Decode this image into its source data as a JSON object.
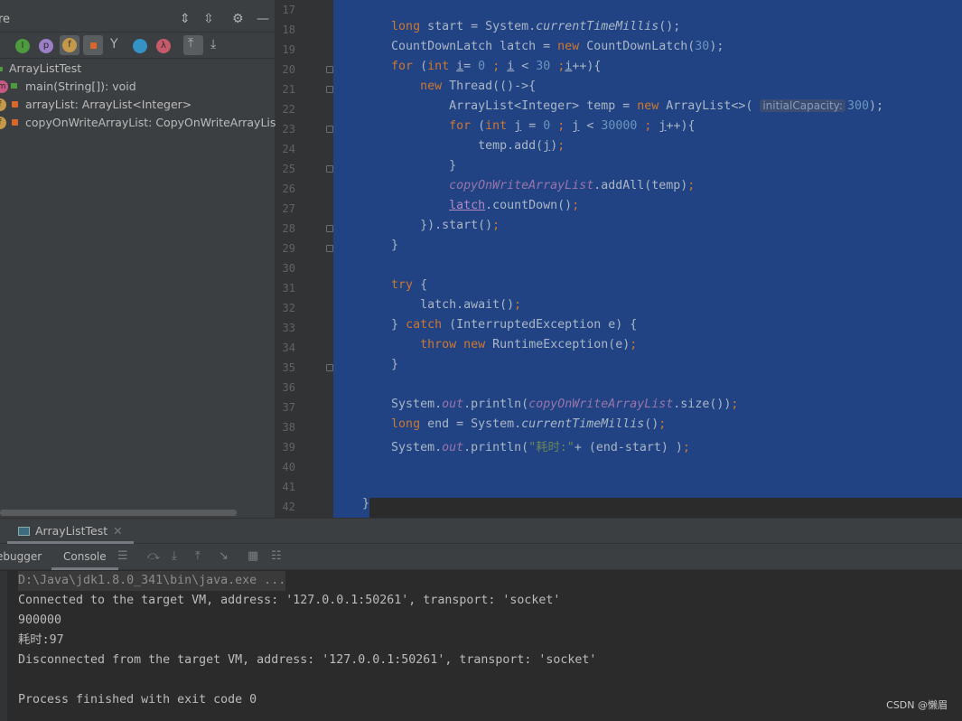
{
  "structure": {
    "title_partial": "re",
    "tree": [
      {
        "label": "ArrayListTest",
        "badge": ""
      },
      {
        "label": "main(String[]): void",
        "badge": "m",
        "color": "#c75a85"
      },
      {
        "label": "arrayList: ArrayList<Integer>",
        "badge": "f",
        "color": "#c49a4a"
      },
      {
        "label": "copyOnWriteArrayList: CopyOnWriteArrayList<In",
        "badge": "f",
        "color": "#c49a4a"
      }
    ],
    "toolbar_icons": [
      "inherited-icon",
      "property-icon",
      "field-icon",
      "private-icon",
      "anonymous-class-icon",
      "lambda-icon"
    ]
  },
  "editor": {
    "lines": [
      {
        "n": 17,
        "seg": []
      },
      {
        "n": 18,
        "seg": [
          [
            "        ",
            ""
          ],
          [
            "long",
            "kw"
          ],
          [
            " start = System.",
            ""
          ],
          [
            "currentTimeMillis",
            "it"
          ],
          [
            "();",
            ""
          ]
        ]
      },
      {
        "n": 19,
        "seg": [
          [
            "        CountDownLatch latch = ",
            ""
          ],
          [
            "new",
            "kw"
          ],
          [
            " CountDownLatch(",
            ""
          ],
          [
            "30",
            "num"
          ],
          [
            ");",
            ""
          ]
        ]
      },
      {
        "n": 20,
        "seg": [
          [
            "        ",
            ""
          ],
          [
            "for",
            "kw"
          ],
          [
            " (",
            ""
          ],
          [
            "int",
            "kw"
          ],
          [
            " ",
            ""
          ],
          [
            "i",
            "ul"
          ],
          [
            "= ",
            ""
          ],
          [
            "0",
            "num"
          ],
          [
            " ",
            ""
          ],
          [
            ";",
            "kw"
          ],
          [
            " ",
            ""
          ],
          [
            "i",
            "ul"
          ],
          [
            " < ",
            ""
          ],
          [
            "30",
            "num"
          ],
          [
            " ",
            ""
          ],
          [
            ";",
            "kw"
          ],
          [
            "i",
            "ul"
          ],
          [
            "++){",
            ""
          ]
        ]
      },
      {
        "n": 21,
        "seg": [
          [
            "            ",
            ""
          ],
          [
            "new",
            "kw"
          ],
          [
            " Thread(()->{",
            ""
          ]
        ]
      },
      {
        "n": 22,
        "seg": [
          [
            "                ArrayList<Integer> temp = ",
            ""
          ],
          [
            "new",
            "kw"
          ],
          [
            " ArrayList<>( ",
            ""
          ],
          [
            "initialCapacity:",
            "hint"
          ],
          [
            "300",
            "num"
          ],
          [
            ");",
            ""
          ]
        ]
      },
      {
        "n": 23,
        "seg": [
          [
            "                ",
            ""
          ],
          [
            "for",
            "kw"
          ],
          [
            " (",
            ""
          ],
          [
            "int",
            "kw"
          ],
          [
            " ",
            ""
          ],
          [
            "j",
            "ul"
          ],
          [
            " = ",
            ""
          ],
          [
            "0",
            "num"
          ],
          [
            " ",
            ""
          ],
          [
            ";",
            "kw"
          ],
          [
            " ",
            ""
          ],
          [
            "j",
            "ul"
          ],
          [
            " < ",
            ""
          ],
          [
            "30000",
            "num"
          ],
          [
            " ",
            ""
          ],
          [
            ";",
            "kw"
          ],
          [
            " ",
            ""
          ],
          [
            "j",
            "ul"
          ],
          [
            "++){",
            ""
          ]
        ]
      },
      {
        "n": 24,
        "seg": [
          [
            "                    temp.add(",
            ""
          ],
          [
            "j",
            "ul"
          ],
          [
            ")",
            ""
          ],
          [
            ";",
            "kw"
          ]
        ]
      },
      {
        "n": 25,
        "seg": [
          [
            "                }",
            ""
          ]
        ]
      },
      {
        "n": 26,
        "seg": [
          [
            "                ",
            ""
          ],
          [
            "copyOnWriteArrayList",
            "fld"
          ],
          [
            ".addAll(temp)",
            ""
          ],
          [
            ";",
            "kw"
          ]
        ]
      },
      {
        "n": 27,
        "seg": [
          [
            "                ",
            ""
          ],
          [
            "latch",
            "ul fl"
          ],
          [
            ".countDown()",
            ""
          ],
          [
            ";",
            "kw"
          ]
        ]
      },
      {
        "n": 28,
        "seg": [
          [
            "            }).start()",
            ""
          ],
          [
            ";",
            "kw"
          ]
        ]
      },
      {
        "n": 29,
        "seg": [
          [
            "        }",
            ""
          ]
        ]
      },
      {
        "n": 30,
        "seg": []
      },
      {
        "n": 31,
        "seg": [
          [
            "        ",
            ""
          ],
          [
            "try",
            "kw"
          ],
          [
            " {",
            ""
          ]
        ]
      },
      {
        "n": 32,
        "seg": [
          [
            "            latch.await()",
            ""
          ],
          [
            ";",
            "kw"
          ]
        ]
      },
      {
        "n": 33,
        "seg": [
          [
            "        } ",
            ""
          ],
          [
            "catch",
            "kw"
          ],
          [
            " (InterruptedException e) {",
            ""
          ]
        ]
      },
      {
        "n": 34,
        "seg": [
          [
            "            ",
            ""
          ],
          [
            "throw",
            "kw"
          ],
          [
            " ",
            ""
          ],
          [
            "new",
            "kw"
          ],
          [
            " RuntimeException(e)",
            ""
          ],
          [
            ";",
            "kw"
          ]
        ]
      },
      {
        "n": 35,
        "seg": [
          [
            "        }",
            ""
          ]
        ]
      },
      {
        "n": 36,
        "seg": []
      },
      {
        "n": 37,
        "seg": [
          [
            "        System.",
            ""
          ],
          [
            "out",
            "fld"
          ],
          [
            ".println(",
            ""
          ],
          [
            "copyOnWriteArrayList",
            "fld"
          ],
          [
            ".size())",
            ""
          ],
          [
            ";",
            "kw"
          ]
        ]
      },
      {
        "n": 38,
        "seg": [
          [
            "        ",
            ""
          ],
          [
            "long",
            "kw"
          ],
          [
            " end = System.",
            ""
          ],
          [
            "currentTimeMillis",
            "it"
          ],
          [
            "()",
            ""
          ],
          [
            ";",
            "kw"
          ]
        ]
      },
      {
        "n": 39,
        "seg": [
          [
            "        System.",
            ""
          ],
          [
            "out",
            "fld"
          ],
          [
            ".println(",
            ""
          ],
          [
            "\"耗时:\"",
            "str"
          ],
          [
            "+ (end-start) )",
            ""
          ],
          [
            ";",
            "kw"
          ]
        ]
      },
      {
        "n": 40,
        "seg": []
      },
      {
        "n": 41,
        "seg": []
      },
      {
        "n": 42,
        "seg": [
          [
            "    }",
            ""
          ]
        ]
      }
    ]
  },
  "run": {
    "tab": "ArrayListTest",
    "tabs": [
      "ebugger",
      "Console"
    ],
    "console": [
      "D:\\Java\\jdk1.8.0_341\\bin\\java.exe ...",
      "Connected to the target VM, address: '127.0.0.1:50261', transport: 'socket'",
      "900000",
      "耗时:97",
      "Disconnected from the target VM, address: '127.0.0.1:50261', transport: 'socket'",
      "",
      "Process finished with exit code 0"
    ]
  },
  "watermark": "CSDN @懒眉"
}
